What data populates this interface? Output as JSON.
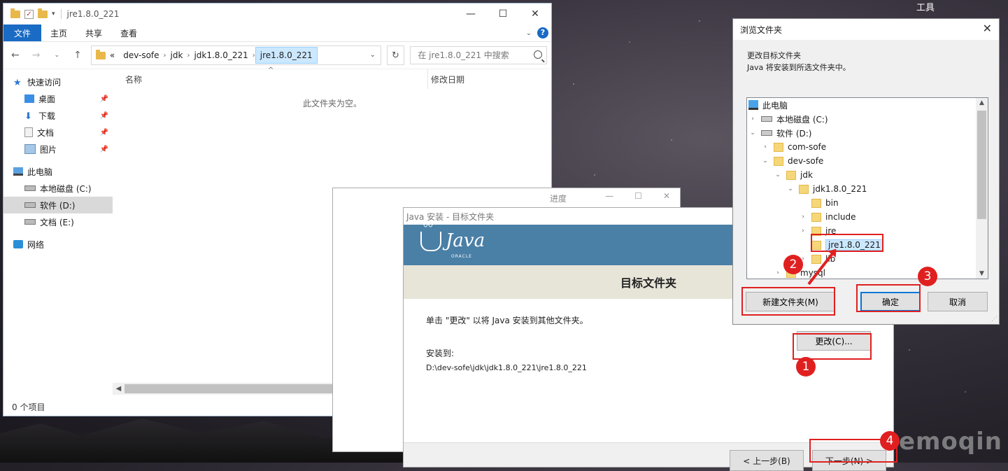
{
  "desktop": {
    "watermark": "emoqin",
    "top_right_label": "工具"
  },
  "explorer": {
    "title": "jre1.8.0_221",
    "ribbon_tabs": [
      "文件",
      "主页",
      "共享",
      "查看"
    ],
    "breadcrumb": [
      "dev-sofe",
      "jdk",
      "jdk1.8.0_221",
      "jre1.8.0_221"
    ],
    "breadcrumb_prefix": "«",
    "search_placeholder": "在 jre1.8.0_221 中搜索",
    "nav": {
      "quick_access": "快速访问",
      "desktop": "桌面",
      "downloads": "下载",
      "documents": "文档",
      "pictures": "图片",
      "this_pc": "此电脑",
      "drive_c": "本地磁盘 (C:)",
      "drive_d": "软件 (D:)",
      "drive_e": "文档 (E:)",
      "network": "网络"
    },
    "columns": {
      "name": "名称",
      "date": "修改日期"
    },
    "empty_message": "此文件夹为空。",
    "status": "0 个项目"
  },
  "progress_window": {
    "title": "进度"
  },
  "java_installer": {
    "title": "Java 安装 - 目标文件夹",
    "logo_text": "Java",
    "logo_sub": "ORACLE",
    "heading": "目标文件夹",
    "instruction": "单击 \"更改\" 以将 Java 安装到其他文件夹。",
    "install_to_label": "安装到:",
    "install_path": "D:\\dev-sofe\\jdk\\jdk1.8.0_221\\jre1.8.0_221",
    "change_button": "更改(C)...",
    "back_button": "< 上一步(B)",
    "next_button": "下一步(N) >"
  },
  "browse_dialog": {
    "title": "浏览文件夹",
    "desc_line1": "更改目标文件夹",
    "desc_line2": "Java 将安装到所选文件夹中。",
    "tree": {
      "this_pc": "此电脑",
      "drive_c": "本地磁盘 (C:)",
      "drive_d": "软件 (D:)",
      "com_sofe": "com-sofe",
      "dev_sofe": "dev-sofe",
      "jdk": "jdk",
      "jdk_ver": "jdk1.8.0_221",
      "bin": "bin",
      "include": "include",
      "jre": "jre",
      "jre_ver": "jre1.8.0_221",
      "lib": "lib",
      "mysql": "mysql"
    },
    "new_folder_button": "新建文件夹(M)",
    "ok_button": "确定",
    "cancel_button": "取消"
  },
  "annotations": {
    "step1": "1",
    "step2": "2",
    "step3": "3",
    "step4": "4",
    "color": "#e02020"
  }
}
